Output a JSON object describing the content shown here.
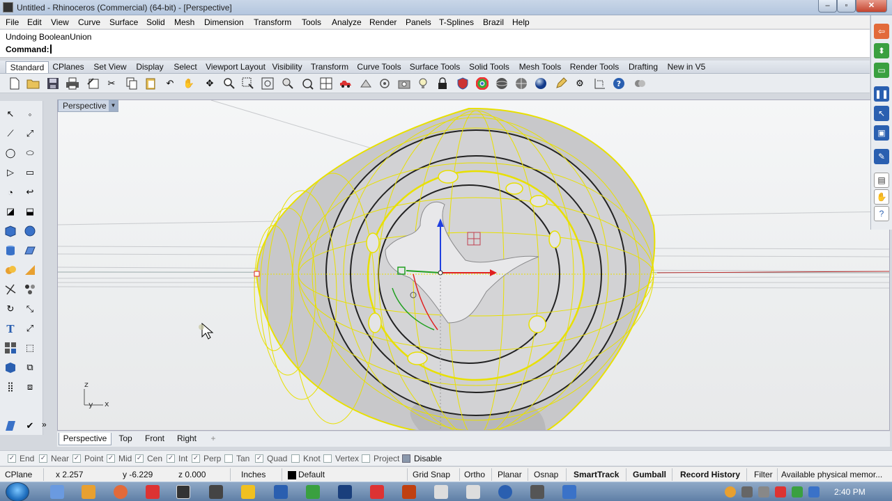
{
  "window": {
    "title": "Untitled - Rhinoceros (Commercial) (64-bit) - [Perspective]",
    "minimize": "–",
    "maximize": "▫",
    "close": "✕"
  },
  "menu": [
    "File",
    "Edit",
    "View",
    "Curve",
    "Surface",
    "Solid",
    "Mesh",
    "Dimension",
    "Transform",
    "Tools",
    "Analyze",
    "Render",
    "Panels",
    "T-Splines",
    "Brazil",
    "Help"
  ],
  "command": {
    "history": "Undoing BooleanUnion",
    "prompt": "Command:",
    "value": ""
  },
  "toolbar_tabs": [
    "Standard",
    "CPlanes",
    "Set View",
    "Display",
    "Select",
    "Viewport Layout",
    "Visibility",
    "Transform",
    "Curve Tools",
    "Surface Tools",
    "Solid Tools",
    "Mesh Tools",
    "Render Tools",
    "Drafting",
    "New in V5"
  ],
  "viewport": {
    "title": "Perspective",
    "axis_z": "z",
    "axis_y": "y",
    "axis_x": "x"
  },
  "viewport_tabs": [
    "Perspective",
    "Top",
    "Front",
    "Right",
    "+"
  ],
  "osnaps": [
    {
      "label": "End",
      "checked": true
    },
    {
      "label": "Near",
      "checked": true
    },
    {
      "label": "Point",
      "checked": true
    },
    {
      "label": "Mid",
      "checked": true
    },
    {
      "label": "Cen",
      "checked": true
    },
    {
      "label": "Int",
      "checked": true
    },
    {
      "label": "Perp",
      "checked": true
    },
    {
      "label": "Tan",
      "checked": false
    },
    {
      "label": "Quad",
      "checked": true
    },
    {
      "label": "Knot",
      "checked": false
    },
    {
      "label": "Vertex",
      "checked": false
    },
    {
      "label": "Project",
      "checked": false
    },
    {
      "label": "Disable",
      "checked": false
    }
  ],
  "status": {
    "cplane": "CPlane",
    "x": "x 2.257",
    "y": "y -6.229",
    "z": "z 0.000",
    "units": "Inches",
    "layer": "Default",
    "layer_color": "#000000",
    "grid_snap": "Grid Snap",
    "ortho": "Ortho",
    "planar": "Planar",
    "osnap": "Osnap",
    "smarttrack": "SmartTrack",
    "gumball": "Gumball",
    "record_history": "Record History",
    "filter": "Filter",
    "memory": "Available physical memor..."
  },
  "taskbar": {
    "clock": "2:40 PM"
  },
  "colors": {
    "wireframe": "#e8e000",
    "accent_blue": "#2a5fb0",
    "x_axis": "#e02020",
    "y_axis": "#20a020",
    "z_axis": "#2040e0"
  }
}
